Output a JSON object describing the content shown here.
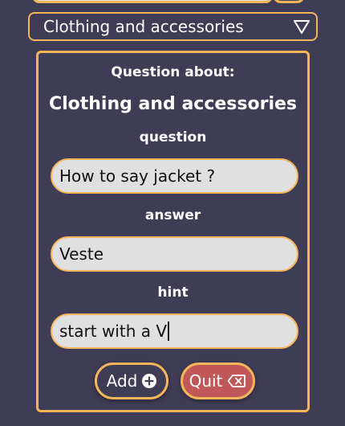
{
  "category": {
    "selected": "Clothing and accessories",
    "icon": "triangle-down-icon"
  },
  "form": {
    "about_label": "Question about:",
    "category_title": "Clothing and accessories",
    "question_label": "question",
    "question_value": "How to say jacket ?",
    "answer_label": "answer",
    "answer_value": "Veste",
    "hint_label": "hint",
    "hint_value": "start with a V"
  },
  "buttons": {
    "add_label": "Add",
    "add_icon": "plus-circle-icon",
    "quit_label": "Quit",
    "quit_icon": "backspace-icon"
  },
  "colors": {
    "background": "#3f3c55",
    "accent": "#f7b55a",
    "field": "#e0e0e0",
    "quit": "#c0585a"
  }
}
